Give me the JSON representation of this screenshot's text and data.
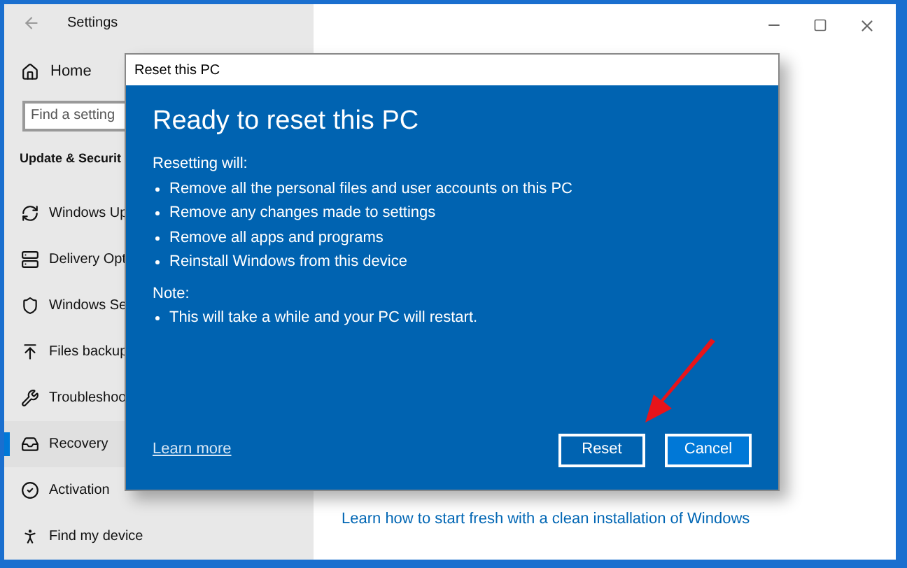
{
  "window": {
    "title": "Settings"
  },
  "sidebar": {
    "home": "Home",
    "search": {
      "placeholder": "Find a setting"
    },
    "section": "Update & Securit",
    "items": [
      {
        "label": "Windows Up",
        "selected": false
      },
      {
        "label": "Delivery Opt",
        "selected": false
      },
      {
        "label": "Windows Se",
        "selected": false
      },
      {
        "label": "Files backup",
        "selected": false
      },
      {
        "label": "Troubleshoo",
        "selected": false
      },
      {
        "label": "Recovery",
        "selected": true
      },
      {
        "label": "Activation",
        "selected": false
      },
      {
        "label": "Find my device",
        "selected": false
      }
    ]
  },
  "content": {
    "link": "Learn how to start fresh with a clean installation of Windows"
  },
  "dialog": {
    "title": "Reset this PC",
    "heading": "Ready to reset this PC",
    "intro": "Resetting will:",
    "bullets": [
      "Remove all the personal files and user accounts on this PC",
      "Remove any changes made to settings",
      "Remove all apps and programs",
      "Reinstall Windows from this device"
    ],
    "note_label": "Note:",
    "note_bullets": [
      "This will take a while and your PC will restart."
    ],
    "learn_more": "Learn more",
    "buttons": [
      {
        "label": "Reset",
        "primary": false
      },
      {
        "label": "Cancel",
        "primary": true
      }
    ]
  }
}
